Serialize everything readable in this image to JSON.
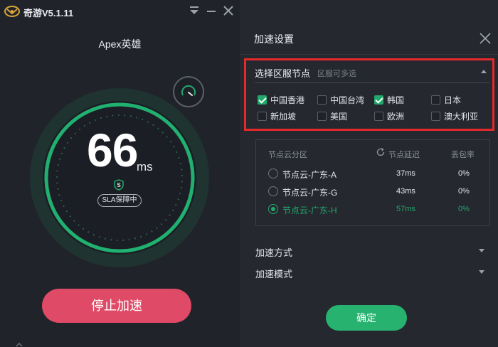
{
  "app": {
    "title": "奇游V5.1.11"
  },
  "left": {
    "game_title": "Apex英雄",
    "latency": "66",
    "latency_unit": "ms",
    "sla_badge": "SLA保障中",
    "stop_button": "停止加速"
  },
  "panel": {
    "title": "加速设置",
    "region": {
      "heading": "选择区服节点",
      "hint": "区服可多选",
      "options": [
        {
          "label": "中国香港",
          "checked": true
        },
        {
          "label": "中国台湾",
          "checked": false
        },
        {
          "label": "韩国",
          "checked": true
        },
        {
          "label": "日本",
          "checked": false
        },
        {
          "label": "新加坡",
          "checked": false
        },
        {
          "label": "美国",
          "checked": false
        },
        {
          "label": "欧洲",
          "checked": false
        },
        {
          "label": "澳大利亚",
          "checked": false
        }
      ]
    },
    "nodes": {
      "col_region": "节点云分区",
      "col_latency": "节点延迟",
      "col_loss": "丢包率",
      "rows": [
        {
          "name": "节点云-广东-A",
          "latency": "37ms",
          "loss": "0%",
          "selected": false
        },
        {
          "name": "节点云-广东-G",
          "latency": "43ms",
          "loss": "0%",
          "selected": false
        },
        {
          "name": "节点云-广东-H",
          "latency": "57ms",
          "loss": "0%",
          "selected": true
        }
      ]
    },
    "accel_method": "加速方式",
    "accel_mode": "加速模式",
    "confirm_button": "确定"
  },
  "colors": {
    "accent_green": "#23a86b",
    "stop_red": "#df4a66",
    "highlight_red": "#e5292b"
  },
  "icons": [
    "app-logo-icon",
    "dropdown-icon",
    "minimize-icon",
    "close-icon",
    "gauge-icon",
    "shield-icon",
    "refresh-icon"
  ]
}
